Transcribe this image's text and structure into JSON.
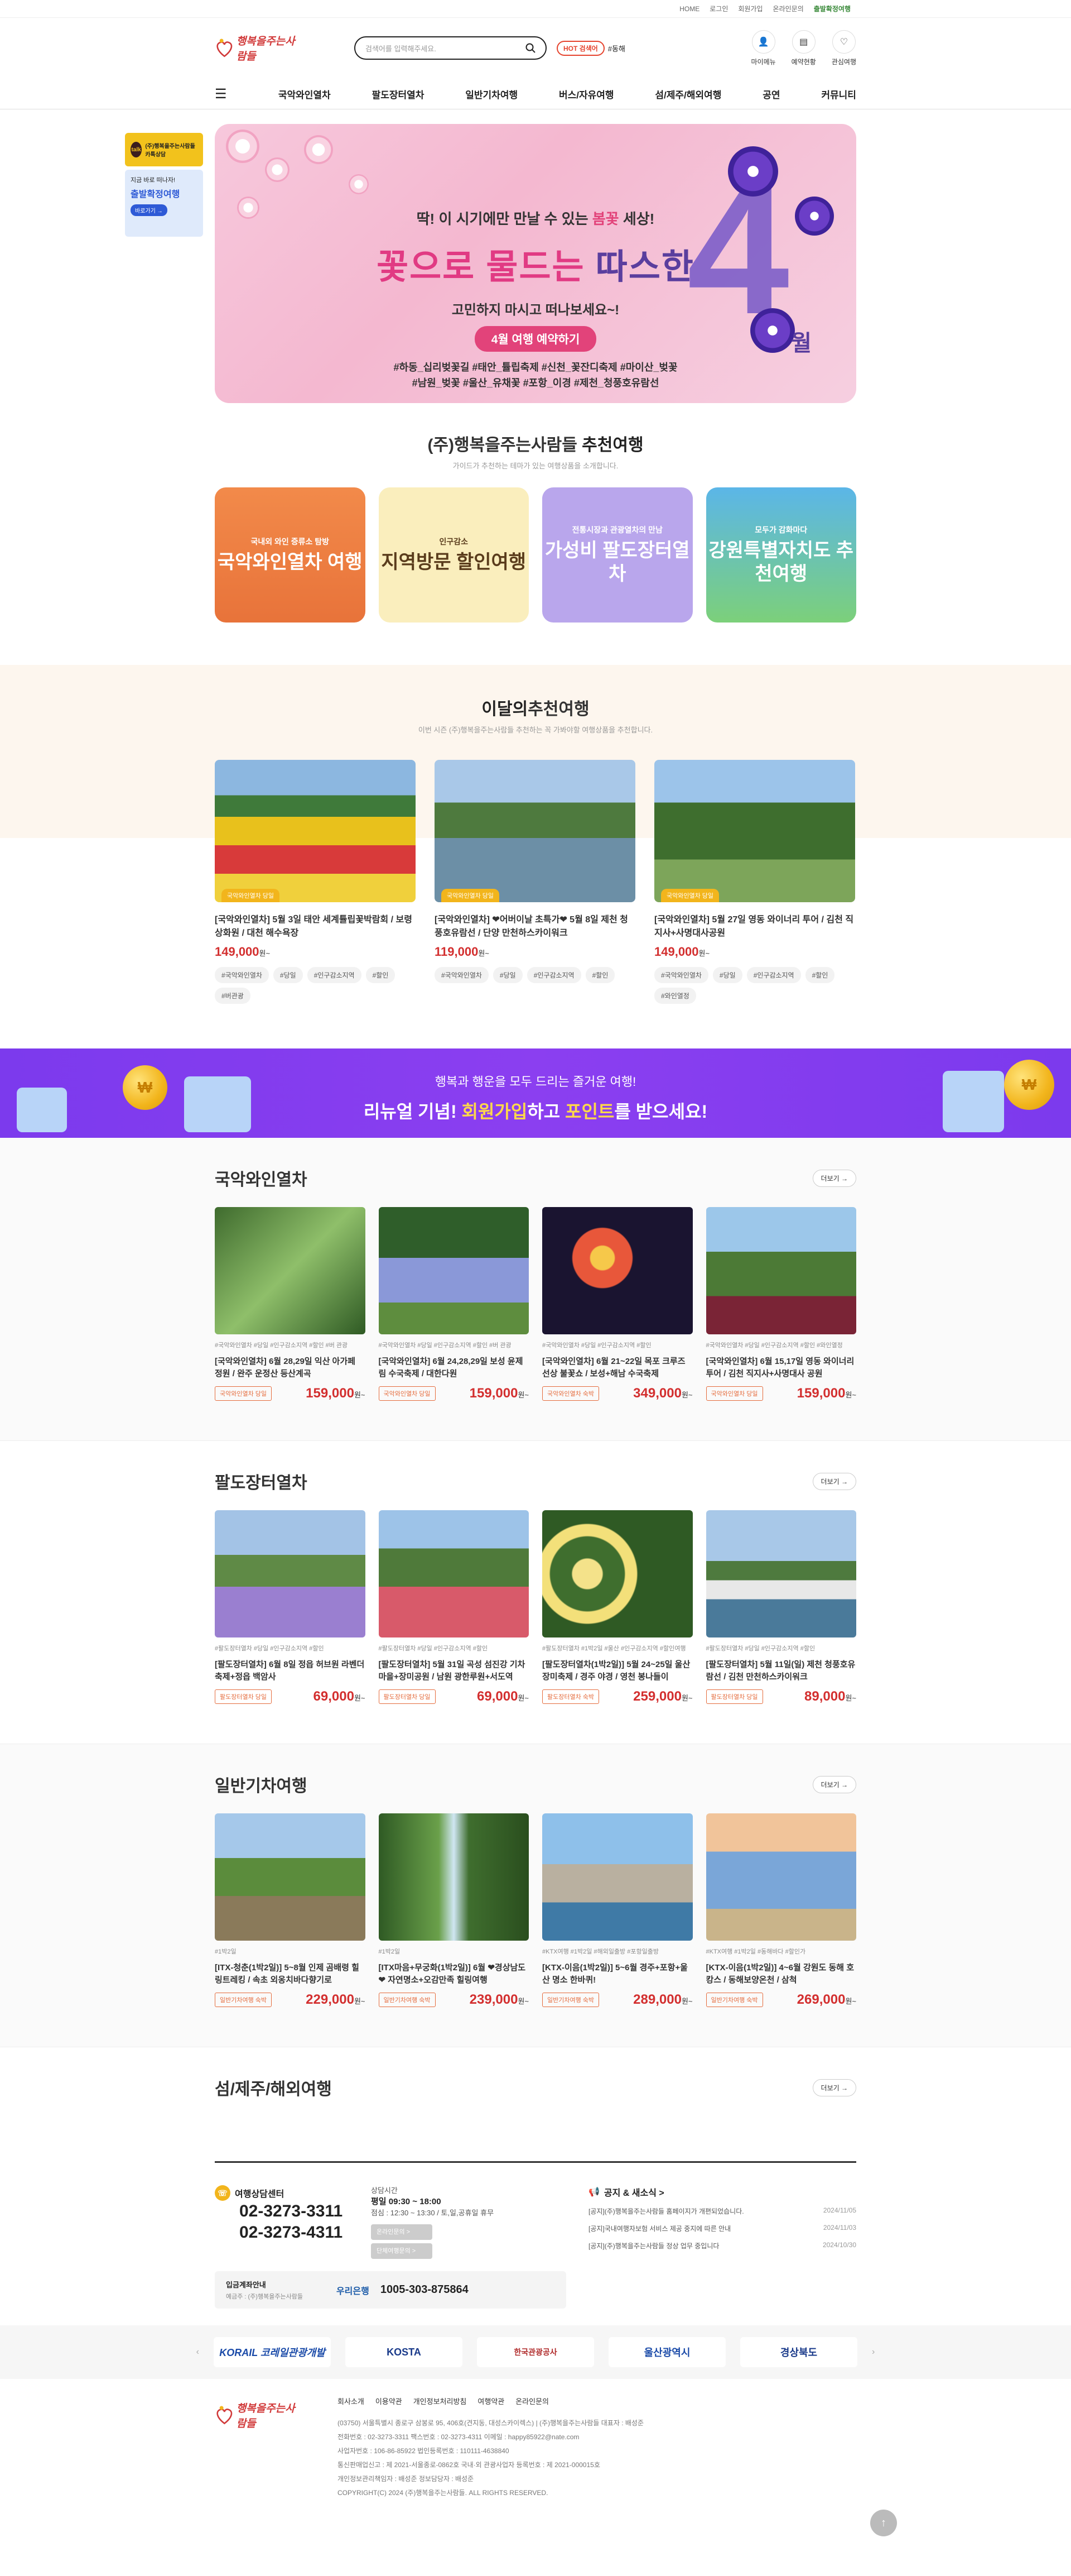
{
  "util": [
    "HOME",
    "로그인",
    "회원가입",
    "온라인문의",
    "출발확정여행"
  ],
  "brand": {
    "name": "행복을주는사람들"
  },
  "search": {
    "placeholder": "검색어를 입력해주세요."
  },
  "hot": {
    "badge": "HOT 검색어",
    "keyword": "#동해"
  },
  "hicons": [
    {
      "label": "마이메뉴",
      "icon": "user-icon"
    },
    {
      "label": "예약현황",
      "icon": "document-icon"
    },
    {
      "label": "관심여행",
      "icon": "heart-icon"
    }
  ],
  "nav": [
    "국악와인열차",
    "팔도장터열차",
    "일반기차여행",
    "버스/자유여행",
    "섬/제주/해외여행",
    "공연",
    "커뮤니티"
  ],
  "side": {
    "b1": "(주)행복을주는사람들 카톡상담",
    "b2a": "지금 바로 떠나자!",
    "b2b": "출발확정여행",
    "b2c": "바로가기 →"
  },
  "hero": {
    "l1a": "딱! 이 시기에만 만날 수 있는 ",
    "l1b": "봄꽃",
    "l1c": " 세상!",
    "l2a": "꽃으로 물드는 ",
    "l2b": "따스한",
    "l3": "고민하지 마시고 떠나보세요~!",
    "l4": "4월 여행 예약하기",
    "l5a": "#하동_십리벚꽃길 #태안_튤립축제 #신천_꽃잔디축제 #마이산_벚꽃",
    "l5b": "#남원_벚꽃 #울산_유채꽃 #포항_이경 #제천_청풍호유람선",
    "num": "4",
    "mon": "월"
  },
  "rec": {
    "title_a": "(주)행복을주는사람들 ",
    "title_b": "추천여행",
    "sub": "가이드가 추천하는 테마가 있는 여행상품을 소개합니다.",
    "cards": [
      {
        "t2": "국내외 와인 증류소 탐방",
        "t1": "국악와인열차 여행"
      },
      {
        "t2": "인구감소",
        "t1": "지역방문 할인여행"
      },
      {
        "t2": "전통시장과 관광열차의 만남",
        "t1": "가성비 팔도장터열차"
      },
      {
        "t2": "모두가 감화마다",
        "t1": "강원특별자치도 추천여행"
      }
    ]
  },
  "monthly": {
    "title_a": "이달의",
    "title_b": "추천여행",
    "sub": "이번 시즌 (주)행복을주는사람들 추천하는 꼭 가봐야할 여행상품을 추천합니다.",
    "items": [
      {
        "tag": "국악와인열차 당일",
        "title": "[국악와인열차] 5월 3일 태안 세계튤립꽃박람회 / 보령 상화원 / 대천 해수욕장",
        "price": "149,000",
        "won": "원~",
        "chips": [
          "#국악와인열차",
          "#당일",
          "#인구감소지역",
          "#할인",
          "#버관광"
        ]
      },
      {
        "tag": "국악와인열차 당일",
        "title": "[국악와인열차] ❤어버이날 초특가❤ 5월 8일 제천 청풍호유람선 / 단양 만천하스카이워크",
        "price": "119,000",
        "won": "원~",
        "chips": [
          "#국악와인열차",
          "#당일",
          "#인구감소지역",
          "#할인"
        ]
      },
      {
        "tag": "국악와인열차 당일",
        "title": "[국악와인열차] 5월 27일 영동 와이너리 투어 / 김천 직지사+사명대사공원",
        "price": "149,000",
        "won": "원~",
        "chips": [
          "#국악와인열차",
          "#당일",
          "#인구감소지역",
          "#할인",
          "#와인열정"
        ]
      }
    ]
  },
  "pbanner": {
    "a": "행복과 행운을 모두 드리는 즐거운 여행!",
    "b1": "리뉴얼 기념! ",
    "b2": "회원가입",
    "b3": "하고 ",
    "b4": "포인트",
    "b5": "를 받으세요!",
    "coin": "₩"
  },
  "more": "더보기 →",
  "sections": [
    {
      "title": "국악와인열차",
      "items": [
        {
          "tags": "#국악와인열차 #당일 #인구감소지역 #할인 #버 관광",
          "title": "[국악와인열차] 6월 28,29일 익산 아가페 정원 / 완주 운정산 등산계곡",
          "cat": "국악와인열차 당일",
          "price": "159,000"
        },
        {
          "tags": "#국악와인열차 #당일 #인구감소지역 #할인 #버 관광",
          "title": "[국악와인열차] 6월 24,28,29일 보성 윤제림 수국축제 / 대한다원",
          "cat": "국악와인열차 당일",
          "price": "159,000"
        },
        {
          "tags": "#국악와인열차 #당일 #인구감소지역 #할인",
          "title": "[국악와인열차] 6월 21~22일 목포 크루즈 선상 불꽃쇼 / 보성+해남 수국축제",
          "cat": "국악와인열차 숙박",
          "price": "349,000"
        },
        {
          "tags": "#국악와인열차 #당일 #인구감소지역 #할인 #와인열정",
          "title": "[국악와인열차] 6월 15,17일 영동 와이너리 투어 / 김천 직지사+사명대사 공원",
          "cat": "국악와인열차 당일",
          "price": "159,000"
        }
      ]
    },
    {
      "title": "팔도장터열차",
      "items": [
        {
          "tags": "#팔도장터열차 #당일 #인구감소지역 #할인",
          "title": "[팔도장터열차] 6월 8일 정읍 허브원 라벤더 축제+정읍 백암사",
          "cat": "팔도장터열차 당일",
          "price": "69,000"
        },
        {
          "tags": "#팔도장터열차 #당일 #인구감소지역 #할인",
          "title": "[팔도장터열차] 5월 31일 곡성 섬진강 기차마을+장미공원 / 남원 광한루원+서도역",
          "cat": "팔도장터열차 당일",
          "price": "69,000"
        },
        {
          "tags": "#팔도장터열차 #1박2일 #울산 #인구감소지역 #할인여행",
          "title": "[팔도장터열차(1박2일)] 5월 24~25일 울산 장미축제 / 경주 야경 / 영천 봉나들이",
          "cat": "팔도장터열차 숙박",
          "price": "259,000"
        },
        {
          "tags": "#팔도장터열차 #당일 #인구감소지역 #할인",
          "title": "[팔도장터열차] 5월 11일(일) 제천 청풍호유람선 / 김천 만천하스카이워크",
          "cat": "팔도장터열차 당일",
          "price": "89,000"
        }
      ]
    },
    {
      "title": "일반기차여행",
      "items": [
        {
          "tags": "#1박2일",
          "title": "[ITX-청춘(1박2일)] 5~8월 인제 곰배령 힐링트레킹 / 속초 외옹치바다향기로",
          "cat": "일반기차여행 숙박",
          "price": "229,000"
        },
        {
          "tags": "#1박2일",
          "title": "[ITX마음+무궁화(1박2일)] 6월 ❤경상남도❤ 자연명소+오감만족 힐링여행",
          "cat": "일반기차여행 숙박",
          "price": "239,000"
        },
        {
          "tags": "#KTX여행 #1박2일 #해외일출방 #포항일출방",
          "title": "[KTX-이음(1박2일)] 5~6월 경주+포항+울산 명소 한바퀴!",
          "cat": "일반기차여행 숙박",
          "price": "289,000"
        },
        {
          "tags": "#KTX여행 #1박2일 #동해바다 #할인가",
          "title": "[KTX-이음(1박2일)] 4~6월 강원도 동해 호캉스 / 동해보양온천 / 삼척",
          "cat": "일반기차여행 숙박",
          "price": "269,000"
        }
      ]
    },
    {
      "title": "섬/제주/해외여행",
      "items": []
    }
  ],
  "footer": {
    "cs_label": "여행상담센터",
    "tel1": "02-3273-3311",
    "tel2": "02-3273-4311",
    "hours_t": "상담시간",
    "hours_a": "평일 09:30 ~ 18:00",
    "hours_b": "점심 : 12:30 ~ 13:30 / 토,일,공휴일 휴무",
    "btn1": "온라인문의 >",
    "btn2": "단체여행문의 >",
    "bank_lbl": "입금계좌안내",
    "bank_sub": "예금주 : (주)행복을주는사람들",
    "bank_name": "우리은행",
    "acct": "1005-303-875864",
    "notice_t": "공지 & 새소식 >",
    "notices": [
      {
        "t": "[공지](주)행복을주는사람들 홈페이지가 개편되었습니다.",
        "d": "2024/11/05"
      },
      {
        "t": "[공지]국내여행자보험 서비스 제공 중지에 따른 안내",
        "d": "2024/11/03"
      },
      {
        "t": "[공지](주)행복을주는사람들 정상 업무 중입니다",
        "d": "2024/10/30"
      }
    ],
    "partners": [
      "KORAIL 코레일관광개발",
      "KOSTA",
      "한국관광공사",
      "울산광역시",
      "경상북도"
    ],
    "links": [
      "회사소개",
      "이용약관",
      "개인정보처리방침",
      "여행약관",
      "온라인문의"
    ],
    "addr": [
      "(03750) 서울특별시 종로구 삼봉로 95, 406호(견지동, 대성스카이렉스) | (주)행복을주는사람들 대표자 : 배성준",
      "전화번호 : 02-3273-3311  팩스번호 : 02-3273-4311  이메일 : happy85922@nate.com",
      "사업자번호 : 106-86-85922  법인등록번호 : 110111-4638840",
      "통신판매업신고 : 제 2021-서울종로-0862호  국내·외 관광사업자 등록번호 : 제 2021-000015호",
      "개인정보관리책임자 : 배성준  정보담당자 : 배성준",
      "COPYRIGHT(C) 2024 (주)행복을주는사람들. ALL RIGHTS RESERVED."
    ]
  }
}
